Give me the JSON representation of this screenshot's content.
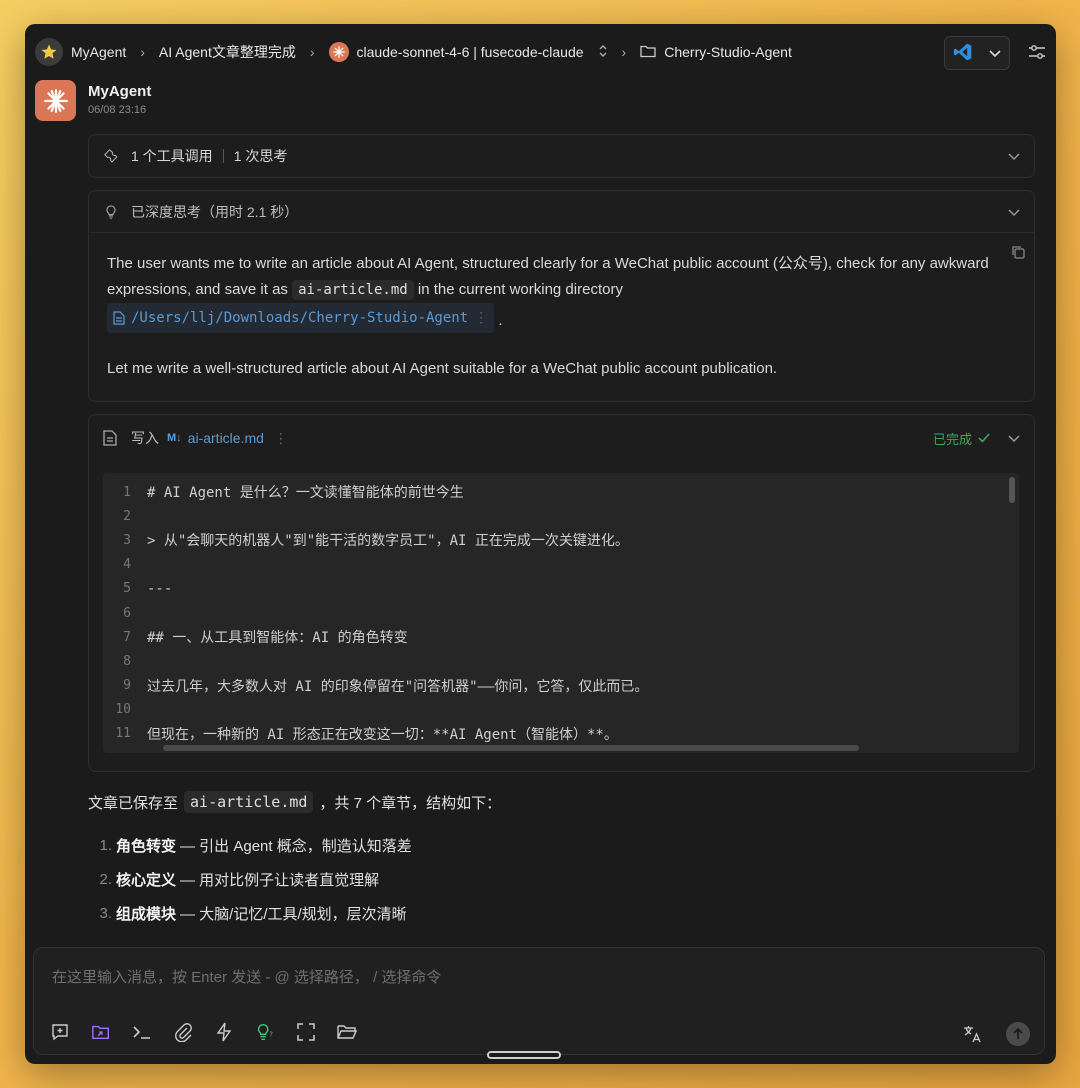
{
  "breadcrumb": {
    "agent": "MyAgent",
    "session": "AI Agent文章整理完成",
    "model": "claude-sonnet-4-6 | fusecode-claude",
    "folder": "Cherry-Studio-Agent"
  },
  "message": {
    "sender": "MyAgent",
    "time": "06/08 23:16"
  },
  "tool_summary": {
    "tool_calls": "1 个工具调用",
    "thinking": "1 次思考"
  },
  "thinking": {
    "header": "已深度思考（用时 2.1 秒）",
    "p1_a": "The user wants me to write an article about AI Agent, structured clearly for a WeChat public account (公众号), check for any awkward expressions, and save it as",
    "p1_code": "ai-article.md",
    "p1_b": "in the current working directory",
    "p1_path": "/Users/llj/Downloads/Cherry-Studio-Agent",
    "p1_end": ".",
    "p2": "Let me write a well-structured article about AI Agent suitable for a WeChat public account publication."
  },
  "write_tool": {
    "action": "写入",
    "file": "ai-article.md",
    "status": "已完成",
    "lines": [
      {
        "n": "1",
        "t": "# AI Agent 是什么？一文读懂智能体的前世今生"
      },
      {
        "n": "2",
        "t": ""
      },
      {
        "n": "3",
        "t": "> 从\"会聊天的机器人\"到\"能干活的数字员工\"，AI 正在完成一次关键进化。"
      },
      {
        "n": "4",
        "t": ""
      },
      {
        "n": "5",
        "t": "---"
      },
      {
        "n": "6",
        "t": ""
      },
      {
        "n": "7",
        "t": "## 一、从工具到智能体：AI 的角色转变"
      },
      {
        "n": "8",
        "t": ""
      },
      {
        "n": "9",
        "t": "过去几年，大多数人对 AI 的印象停留在\"问答机器\"——你问，它答，仅此而已。"
      },
      {
        "n": "10",
        "t": ""
      },
      {
        "n": "11",
        "t": "但现在，一种新的 AI 形态正在改变这一切：**AI Agent（智能体）**。"
      }
    ]
  },
  "summary": {
    "prefix": "文章已保存至",
    "file": "ai-article.md",
    "suffix": "，共 7 个章节，结构如下：",
    "items": [
      {
        "num": "1.",
        "title": "角色转变",
        "desc": "— 引出 Agent 概念，制造认知落差"
      },
      {
        "num": "2.",
        "title": "核心定义",
        "desc": "— 用对比例子让读者直觉理解"
      },
      {
        "num": "3.",
        "title": "组成模块",
        "desc": "— 大脑/记忆/工具/规划，层次清晰"
      }
    ]
  },
  "input": {
    "placeholder": "在这里输入消息，按 Enter 发送 - @ 选择路径， / 选择命令"
  }
}
